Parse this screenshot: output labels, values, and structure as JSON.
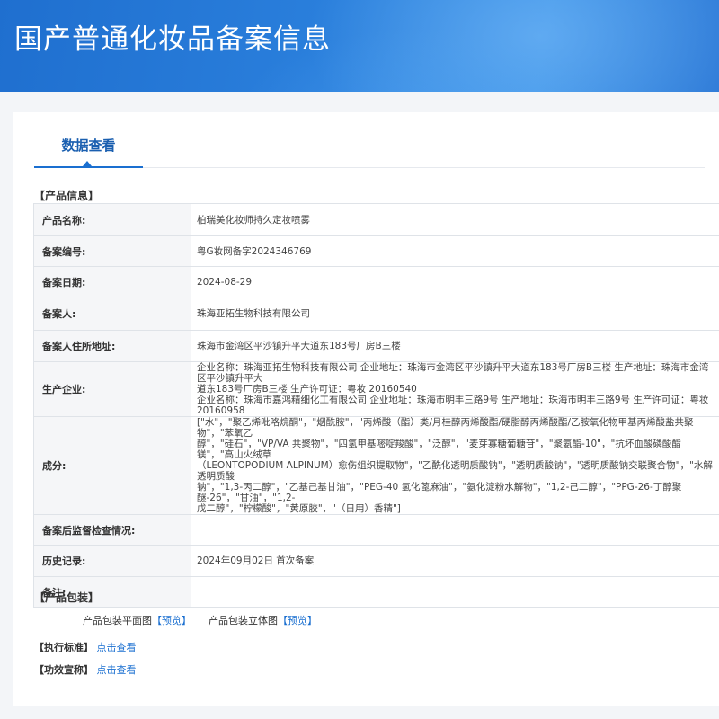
{
  "header": {
    "title": "国产普通化妆品备案信息"
  },
  "tabs": [
    {
      "label": "数据查看"
    }
  ],
  "product_info": {
    "section_label": "【产品信息】",
    "rows": [
      {
        "label": "产品名称:",
        "value": "柏瑞美化妆师持久定妆喷雾"
      },
      {
        "label": "备案编号:",
        "value": "粤G妆网备字2024346769"
      },
      {
        "label": "备案日期:",
        "value": "2024-08-29"
      },
      {
        "label": "备案人:",
        "value": "珠海亚拓生物科技有限公司"
      },
      {
        "label": "备案人住所地址:",
        "value": "珠海市金湾区平沙镇升平大道东183号厂房B三楼"
      },
      {
        "label": "生产企业:",
        "lines": [
          "企业名称：珠海亚拓生物科技有限公司 企业地址：珠海市金湾区平沙镇升平大道东183号厂房B三楼 生产地址：珠海市金湾区平沙镇升平大",
          "道东183号厂房B三楼 生产许可证：粤妆 20160540",
          "企业名称：珠海市嘉鸿精细化工有限公司 企业地址：珠海市明丰三路9号 生产地址：珠海市明丰三路9号 生产许可证：粤妆20160958"
        ]
      },
      {
        "label": "成分:",
        "lines": [
          "[\"水\"，\"聚乙烯吡咯烷酮\"，\"烟酰胺\"，\"丙烯酸（酯）类/月桂醇丙烯酸酯/硬脂醇丙烯酸酯/乙胺氧化物甲基丙烯酸盐共聚物\"，\"苯氧乙",
          "醇\"，\"硅石\"，\"VP/VA 共聚物\"，\"四氢甲基嘧啶羧酸\"，\"泛醇\"，\"麦芽寡糖葡糖苷\"，\"聚氨酯-10\"，\"抗坏血酸磷酸酯镁\"，\"高山火绒草",
          "（LEONTOPODIUM ALPINUM）愈伤组织提取物\"，\"乙酰化透明质酸钠\"，\"透明质酸钠\"，\"透明质酸钠交联聚合物\"，\"水解透明质酸",
          "钠\"，\"1,3-丙二醇\"，\"乙基己基甘油\"，\"PEG-40 氢化蓖麻油\"，\"氨化淀粉水解物\"，\"1,2-己二醇\"，\"PPG-26-丁醇聚醚-26\"，\"甘油\"，\"1,2-",
          "戊二醇\"，\"柠檬酸\"，\"黄原胶\"，\"（日用）香精\"]"
        ]
      },
      {
        "label": "备案后监督检查情况:",
        "value": ""
      },
      {
        "label": "历史记录:",
        "value": "2024年09月02日 首次备案"
      },
      {
        "label": "备注:",
        "value": ""
      }
    ]
  },
  "packaging": {
    "section_label": "【产品包装】",
    "flat": {
      "label": "产品包装平面图",
      "link": "【预览】"
    },
    "solid": {
      "label": "产品包装立体图",
      "link": "【预览】"
    }
  },
  "standard": {
    "label": "【执行标准】",
    "link": "点击查看"
  },
  "efficacy": {
    "label": "【功效宣称】",
    "link": "点击查看"
  }
}
